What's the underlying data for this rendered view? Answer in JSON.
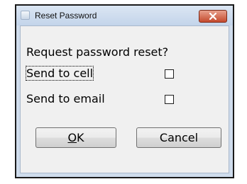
{
  "window": {
    "title": "Reset Password"
  },
  "dialog": {
    "prompt": "Request password reset?",
    "options": [
      {
        "label": "Send to cell",
        "checked": false
      },
      {
        "label": "Send to email",
        "checked": false
      }
    ],
    "buttons": {
      "ok_mnemonic": "O",
      "ok_rest": "K",
      "cancel": "Cancel"
    }
  },
  "colors": {
    "titlebar": "#c3d4ea",
    "close_button": "#c44a2e",
    "client_background": "#f0f0f0"
  }
}
